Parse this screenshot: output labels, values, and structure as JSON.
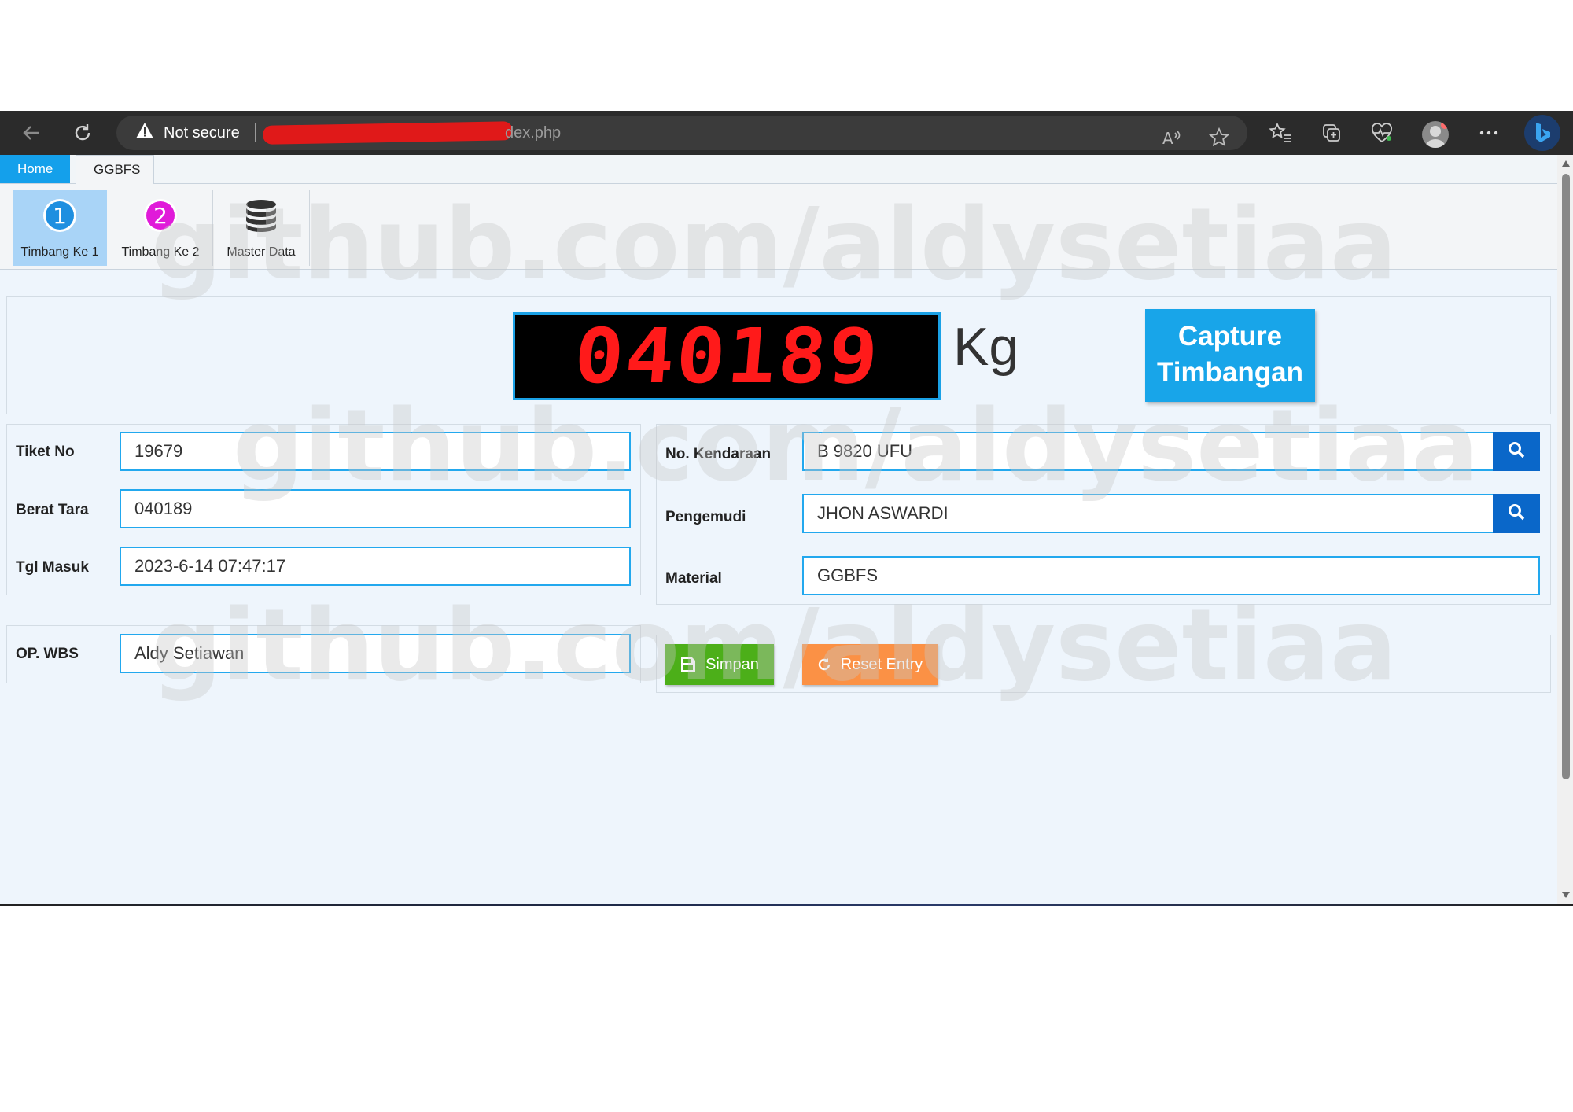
{
  "browser": {
    "security_label": "Not secure",
    "url_visible": "dex.php"
  },
  "tabs": [
    {
      "label": "Home",
      "active": true
    },
    {
      "label": "GGBFS",
      "active": false
    }
  ],
  "ribbon": [
    {
      "label": "Timbang Ke 1",
      "icon": "number-1-icon",
      "selected": true
    },
    {
      "label": "Timbang Ke 2",
      "icon": "number-2-icon",
      "selected": false
    },
    {
      "label": "Master Data",
      "icon": "database-icon",
      "selected": false
    }
  ],
  "icons": {
    "one": "1",
    "two": "2"
  },
  "scale": {
    "reading": "040189",
    "unit": "Kg",
    "capture_line1": "Capture",
    "capture_line2": "Timbangan"
  },
  "watermark": "github.com/aldysetiaa",
  "form_left": {
    "tiket_no": {
      "label": "Tiket No",
      "value": "19679"
    },
    "berat_tara": {
      "label": "Berat Tara",
      "value": "040189"
    },
    "tgl_masuk": {
      "label": "Tgl Masuk",
      "value": "2023-6-14 07:47:17"
    },
    "op_wbs": {
      "label": "OP. WBS",
      "value": "Aldy Setiawan"
    }
  },
  "form_right": {
    "no_kendaraan": {
      "label": "No. Kendaraan",
      "value": "B 9820 UFU"
    },
    "pengemudi": {
      "label": "Pengemudi",
      "value": "JHON ASWARDI"
    },
    "material": {
      "label": "Material",
      "value": "GGBFS"
    }
  },
  "actions": {
    "simpan": "Simpan",
    "reset": "Reset Entry"
  },
  "colors": {
    "accent": "#14a0eb",
    "simpan": "#4caf19",
    "reset": "#fb9145",
    "lcd_digits": "#ff1a1a",
    "search": "#0a67c9"
  }
}
